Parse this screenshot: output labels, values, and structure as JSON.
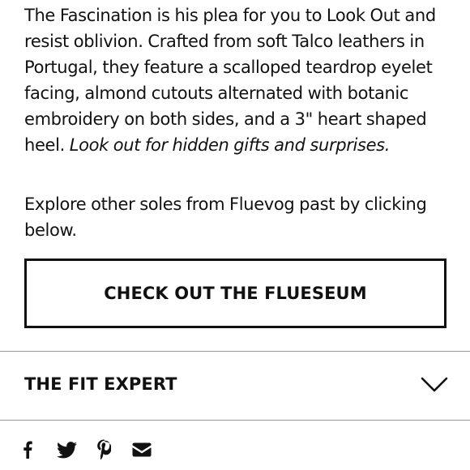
{
  "product": {
    "description_main": "The Fascination is his plea for you to Look Out and resist oblivion. Crafted from soft Talco leathers in Portugal, they feature a scalloped teardrop eyelet facing, almond cutouts alternated with botanic embroidery on both sides, and a 3\" heart shaped heel.",
    "description_italic": "Look out for hidden gifts and surprises.",
    "explore_text": "Explore other soles from Fluevog past by clicking below."
  },
  "flueseum_button": {
    "label": "CHECK OUT THE FLUESEUM"
  },
  "accordion": {
    "fit_expert": {
      "title": "THE FIT EXPERT",
      "expanded": false,
      "icon": "chevron-down-icon"
    }
  },
  "share": {
    "icons": [
      "facebook-icon",
      "twitter-icon",
      "pinterest-icon",
      "email-icon"
    ]
  },
  "colors": {
    "text": "#111111",
    "divider": "#9a9a9a",
    "background": "#ffffff"
  }
}
